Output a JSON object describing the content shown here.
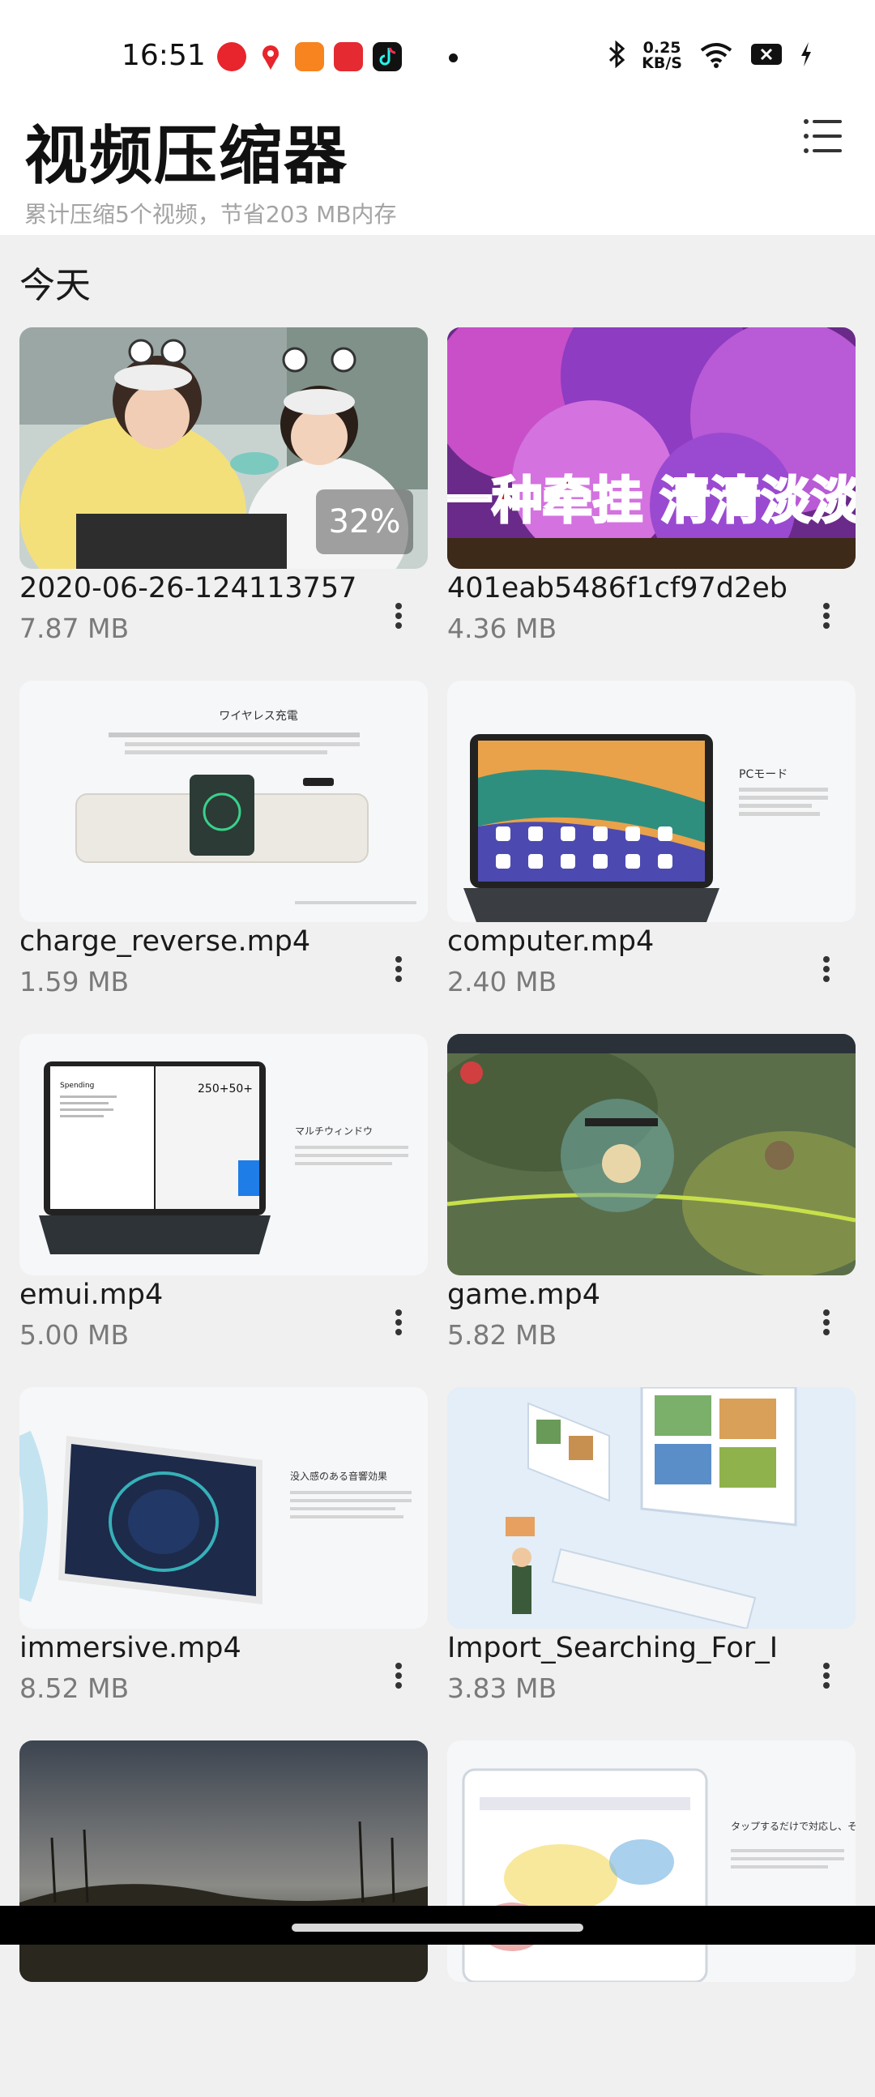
{
  "status_bar": {
    "time": "16:51",
    "net_speed_value": "0.25",
    "net_speed_unit": "KB/S",
    "icons": [
      "bluetooth-icon",
      "wifi-icon",
      "battery-icon",
      "charging-icon"
    ]
  },
  "header": {
    "title": "视频压缩器",
    "subtitle": "累计压缩5个视频，节省203 MB内存"
  },
  "section": {
    "title": "今天"
  },
  "videos": [
    {
      "name": "2020-06-26-124113757.",
      "size": "7.87 MB",
      "progress": "32%"
    },
    {
      "name": "401eab5486f1cf97d2eb",
      "size": "4.36 MB",
      "overlay_text": "一种牵挂 清清淡淡"
    },
    {
      "name": "charge_reverse.mp4",
      "size": "1.59 MB",
      "thumb_heading": "ワイヤレス充電"
    },
    {
      "name": "computer.mp4",
      "size": "2.40 MB",
      "thumb_heading": "PCモード"
    },
    {
      "name": "emui.mp4",
      "size": "5.00 MB",
      "thumb_heading": "マルチウィンドウ",
      "thumb_calc": "250+50+",
      "thumb_app": "Spending"
    },
    {
      "name": "game.mp4",
      "size": "5.82 MB"
    },
    {
      "name": "immersive.mp4",
      "size": "8.52 MB",
      "thumb_heading": "没入感のある音響効果"
    },
    {
      "name": "Import_Searching_For_I",
      "size": "3.83 MB"
    },
    {
      "name": "",
      "size": ""
    },
    {
      "name": "",
      "size": "",
      "thumb_heading": "タップするだけで対応し、そのまま使える"
    }
  ],
  "colors": {
    "accent": "#1a1a1a",
    "subtitle": "#a3a3a3",
    "background": "#f0f0f0"
  }
}
